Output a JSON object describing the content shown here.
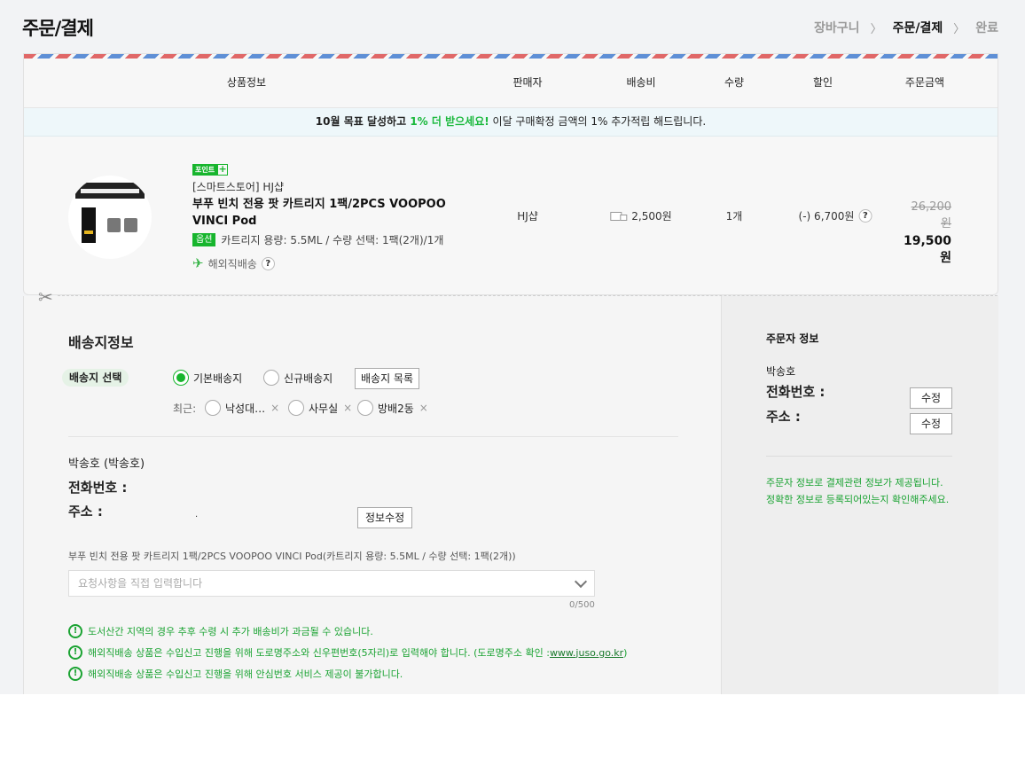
{
  "header": {
    "title": "주문/결제",
    "steps": [
      "장바구니",
      "주문/결제",
      "완료"
    ]
  },
  "table": {
    "columns": [
      "상품정보",
      "판매자",
      "배송비",
      "수량",
      "할인",
      "주문금액"
    ]
  },
  "promo": {
    "part1": "10월 목표 달성하고 ",
    "pct": "1% 더 받으세요!",
    "part2": " 이달 구매확정 금액의 1% 추가적립 해드립니다."
  },
  "product": {
    "point_badge": "포인트",
    "point_plus": "+",
    "store": "[스마트스토어] HJ샵",
    "name": "부푸 빈치 전용 팟 카트리지 1팩/2PCS VOOPOO VINCI Pod",
    "option_tag": "옵션",
    "option_text": "카트리지 용량: 5.5ML / 수량 선택: 1팩(2개)/1개",
    "overseas": "해외직배송",
    "seller": "HJ샵",
    "shipping": "2,500원",
    "qty": "1개",
    "discount": "(-) 6,700원",
    "original_price": "26,200원",
    "final_price": "19,500원",
    "help_icon": "?"
  },
  "shipping_form": {
    "title": "배송지정보",
    "select_label": "배송지 선택",
    "radio_default": "기본배송지",
    "radio_new": "신규배송지",
    "list_button": "배송지 목록",
    "recent_label": "최근:",
    "recent": [
      "낙성대…",
      "사무실",
      "방배2동"
    ],
    "remove": "×",
    "receiver_name": "박송호 (박송호)",
    "phone_label": "전화번호 :",
    "addr_label": "주소 :",
    "addr_value": ".",
    "edit_button": "정보수정",
    "req_title": "부푸 빈치 전용 팟 카트리지 1팩/2PCS VOOPOO VINCI Pod(카트리지 용량: 5.5ML / 수량 선택: 1팩(2개))",
    "req_placeholder": "요청사항을 직접 입력합니다",
    "counter": "0/500",
    "notices": [
      "도서산간 지역의 경우 추후 수령 시 추가 배송비가 과금될 수 있습니다.",
      "해외직배송 상품은 수입신고 진행을 위해 도로명주소와 신우편번호(5자리)로 입력해야 합니다. (도로명주소 확인 : ",
      "해외직배송 상품은 수입신고 진행을 위해 안심번호 서비스 제공이 불가합니다."
    ],
    "notice_link": "www.juso.go.kr",
    "notice_tail": ")",
    "notice_icon": "!"
  },
  "orderer": {
    "title": "주문자 정보",
    "name": "박송호",
    "phone_label": "전화번호 :",
    "addr_label": "주소 :",
    "edit": "수정",
    "note": "주문자 정보로 결제관련 정보가 제공됩니다.\n정확한 정보로 등록되어있는지 확인해주세요."
  },
  "colors": {
    "accent_green": "#17b52d",
    "promo_bg": "#eef7fa",
    "airmail_red": "#e06767",
    "airmail_blue": "#5e8fd6"
  }
}
